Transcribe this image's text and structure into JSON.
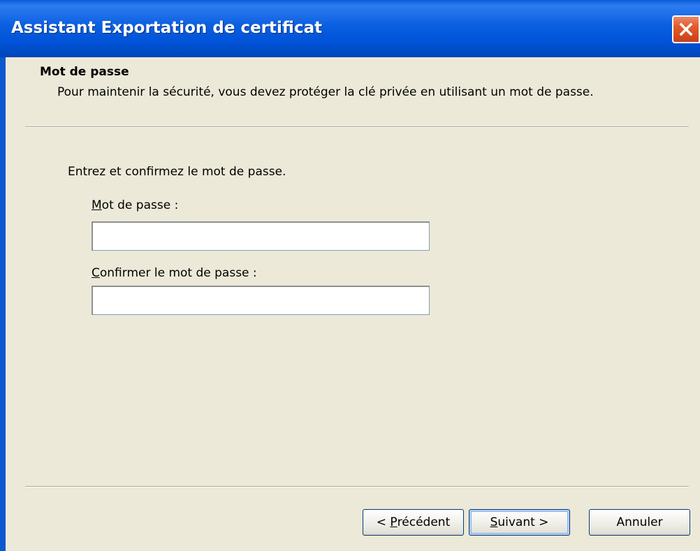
{
  "window": {
    "title": "Assistant Exportation de certificat"
  },
  "header": {
    "title": "Mot de passe",
    "description": "Pour maintenir la sécurité, vous devez protéger la clé privée en utilisant un mot de passe."
  },
  "body": {
    "instruction": "Entrez et confirmez le mot de passe.",
    "password": {
      "label_mnemonic": "M",
      "label_rest": "ot de passe :",
      "value": ""
    },
    "confirm": {
      "label_mnemonic": "C",
      "label_rest": "onfirmer le mot de passe :",
      "value": ""
    }
  },
  "buttons": {
    "back": {
      "prefix": "< ",
      "mnemonic": "P",
      "rest": "récédent"
    },
    "next": {
      "mnemonic": "S",
      "rest": "uivant >"
    },
    "cancel": {
      "label": "Annuler"
    }
  },
  "icons": {
    "close": "close-icon"
  },
  "colors": {
    "titlebar": "#0a5fe0",
    "background": "#ece9d8",
    "close_button": "#e35a2a"
  }
}
